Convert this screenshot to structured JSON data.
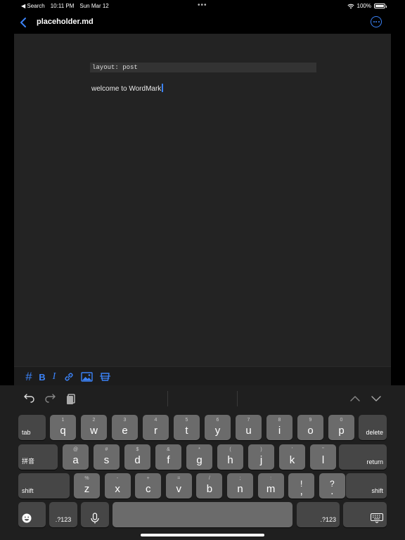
{
  "status_bar": {
    "back_app": "◀ Search",
    "time": "10:11 PM",
    "date": "Sun Mar 12",
    "battery": "100%",
    "battery_level": 1.0
  },
  "nav": {
    "title": "placeholder.md"
  },
  "editor": {
    "front_matter": "layout: post",
    "body_text": "welcome to WordMark"
  },
  "md_toolbar": {
    "heading": "#",
    "bold": "B",
    "italic": "I"
  },
  "keyboard": {
    "row1": [
      {
        "hint": "1",
        "key": "q"
      },
      {
        "hint": "2",
        "key": "w"
      },
      {
        "hint": "3",
        "key": "e"
      },
      {
        "hint": "4",
        "key": "r"
      },
      {
        "hint": "5",
        "key": "t"
      },
      {
        "hint": "6",
        "key": "y"
      },
      {
        "hint": "7",
        "key": "u"
      },
      {
        "hint": "8",
        "key": "i"
      },
      {
        "hint": "9",
        "key": "o"
      },
      {
        "hint": "0",
        "key": "p"
      }
    ],
    "row2": [
      {
        "hint": "@",
        "key": "a"
      },
      {
        "hint": "#",
        "key": "s"
      },
      {
        "hint": "$",
        "key": "d"
      },
      {
        "hint": "&",
        "key": "f"
      },
      {
        "hint": "*",
        "key": "g"
      },
      {
        "hint": "(",
        "key": "h"
      },
      {
        "hint": ")",
        "key": "j"
      },
      {
        "hint": "'",
        "key": "k"
      },
      {
        "hint": "\"",
        "key": "l"
      }
    ],
    "row3": [
      {
        "hint": "%",
        "key": "z"
      },
      {
        "hint": "-",
        "key": "x"
      },
      {
        "hint": "+",
        "key": "c"
      },
      {
        "hint": "=",
        "key": "v"
      },
      {
        "hint": "/",
        "key": "b"
      },
      {
        "hint": ";",
        "key": "n"
      },
      {
        "hint": ":",
        "key": "m"
      },
      {
        "hint": "!",
        "key": ","
      },
      {
        "hint": "?",
        "key": "."
      }
    ],
    "tab": "tab",
    "delete": "delete",
    "pinyin": "拼音",
    "return": "return",
    "shift_left": "shift",
    "shift_right": "shift",
    "numbers_left": ".?123",
    "numbers_right": ".?123"
  },
  "colors": {
    "accent": "#3b82f6",
    "editor_bg": "#232323",
    "key_bg": "#6b6b6b"
  }
}
